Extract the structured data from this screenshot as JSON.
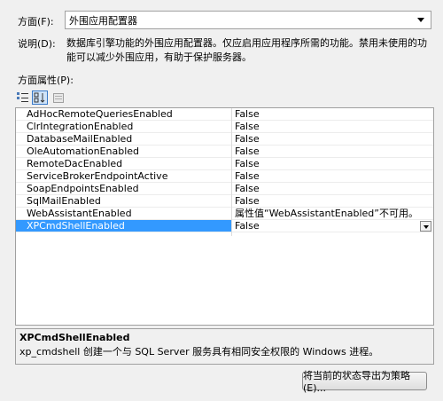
{
  "facet": {
    "label": "方面(F):",
    "selected": "外围应用配置器"
  },
  "description": {
    "label": "说明(D):",
    "text": "数据库引擎功能的外围应用配置器。仅应启用应用程序所需的功能。禁用未使用的功能可以减少外围应用，有助于保护服务器。"
  },
  "properties": {
    "label": "方面属性(P):",
    "rows": [
      {
        "name": "AdHocRemoteQueriesEnabled",
        "value": "False"
      },
      {
        "name": "ClrIntegrationEnabled",
        "value": "False"
      },
      {
        "name": "DatabaseMailEnabled",
        "value": "False"
      },
      {
        "name": "OleAutomationEnabled",
        "value": "False"
      },
      {
        "name": "RemoteDacEnabled",
        "value": "False"
      },
      {
        "name": "ServiceBrokerEndpointActive",
        "value": "False"
      },
      {
        "name": "SoapEndpointsEnabled",
        "value": "False"
      },
      {
        "name": "SqlMailEnabled",
        "value": "False"
      },
      {
        "name": "WebAssistantEnabled",
        "value": "属性值“WebAssistantEnabled”不可用。"
      },
      {
        "name": "XPCmdShellEnabled",
        "value": "False"
      }
    ],
    "selected_index": 9
  },
  "help": {
    "title": "XPCmdShellEnabled",
    "text": "xp_cmdshell 创建一个与 SQL Server 服务具有相同安全权限的 Windows 进程。"
  },
  "export_button": "将当前的状态导出为策略(E)...",
  "toolbar_icons": [
    "categorized-icon",
    "alphabetical-icon",
    "property-pages-icon"
  ],
  "colors": {
    "selection": "#3399ff",
    "window": "#f0f0f0"
  }
}
